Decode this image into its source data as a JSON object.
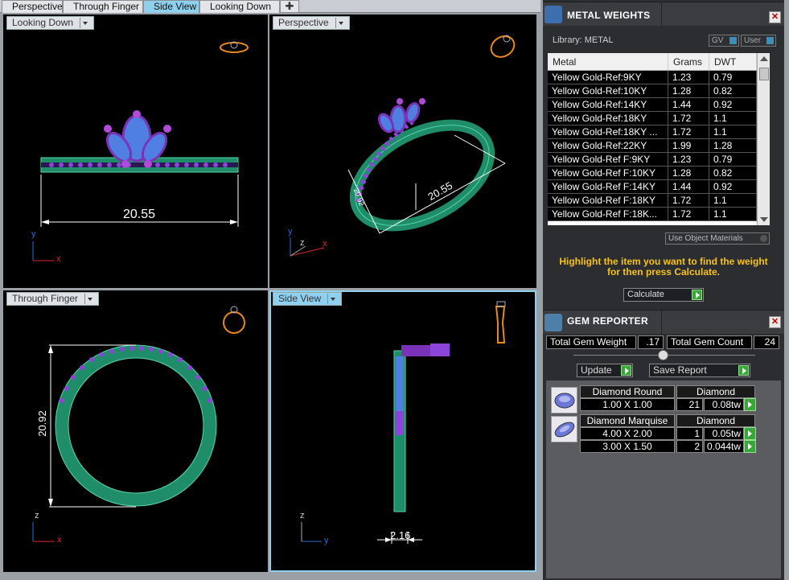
{
  "tabs": [
    {
      "label": "Perspective"
    },
    {
      "label": "Through Finger"
    },
    {
      "label": "Side View"
    },
    {
      "label": "Looking Down"
    }
  ],
  "viewports": {
    "top_left": {
      "label": "Looking Down",
      "dimension": "20.55",
      "axes": [
        "y",
        "x"
      ]
    },
    "top_right": {
      "label": "Perspective",
      "dimension": "20.55",
      "dimension_small": "20.92",
      "axes": [
        "y",
        "z",
        "x"
      ]
    },
    "bottom_left": {
      "label": "Through Finger",
      "dimension": "20.92",
      "axes": [
        "z",
        "x"
      ]
    },
    "bottom_right": {
      "label": "Side View",
      "dimension": "2.16",
      "axes": [
        "z",
        "y"
      ]
    }
  },
  "metal_weights": {
    "title": "METAL WEIGHTS",
    "library_label": "Library: METAL",
    "toggle_gv": "GV",
    "toggle_user": "User",
    "columns": [
      "Metal",
      "Grams",
      "DWT"
    ],
    "rows": [
      [
        "Yellow Gold-Ref:9KY",
        "1.23",
        "0.79"
      ],
      [
        "Yellow Gold-Ref:10KY",
        "1.28",
        "0.82"
      ],
      [
        "Yellow Gold-Ref:14KY",
        "1.44",
        "0.92"
      ],
      [
        "Yellow Gold-Ref:18KY",
        "1.72",
        "1.1"
      ],
      [
        "Yellow Gold-Ref:18KY ...",
        "1.72",
        "1.1"
      ],
      [
        "Yellow Gold-Ref:22KY",
        "1.99",
        "1.28"
      ],
      [
        "Yellow Gold-Ref F:9KY",
        "1.23",
        "0.79"
      ],
      [
        "Yellow Gold-Ref F:10KY",
        "1.28",
        "0.82"
      ],
      [
        "Yellow Gold-Ref F:14KY",
        "1.44",
        "0.92"
      ],
      [
        "Yellow Gold-Ref F:18KY",
        "1.72",
        "1.1"
      ],
      [
        "Yellow Gold-Ref F:18K...",
        "1.72",
        "1.1"
      ]
    ],
    "use_object_materials": "Use Object Materials",
    "hint_line1": "Highlight the item you want to find the weight",
    "hint_line2": "for then press Calculate.",
    "calculate": "Calculate"
  },
  "gem_reporter": {
    "title": "GEM REPORTER",
    "total_weight_label": "Total Gem Weight",
    "total_weight_value": ".17",
    "total_count_label": "Total Gem Count",
    "total_count_value": "24",
    "update_label": "Update",
    "save_report_label": "Save Report",
    "groups": [
      {
        "cut": "Diamond Round",
        "material": "Diamond",
        "items": [
          {
            "size": "1.00 X 1.00",
            "count": "21",
            "weight": "0.08tw"
          }
        ]
      },
      {
        "cut": "Diamond Marquise",
        "material": "Diamond",
        "items": [
          {
            "size": "4.00 X 2.00",
            "count": "1",
            "weight": "0.05tw"
          },
          {
            "size": "3.00 X 1.50",
            "count": "2",
            "weight": "0.044tw"
          }
        ]
      }
    ]
  },
  "colors": {
    "ring_green": "#1f8c6a",
    "gem_purple": "#7a32b8",
    "gem_blue": "#4f7fe0",
    "dimension_white": "#ffffff",
    "tab_active": "#8fd0ef",
    "hint_yellow": "#f6c21d"
  }
}
